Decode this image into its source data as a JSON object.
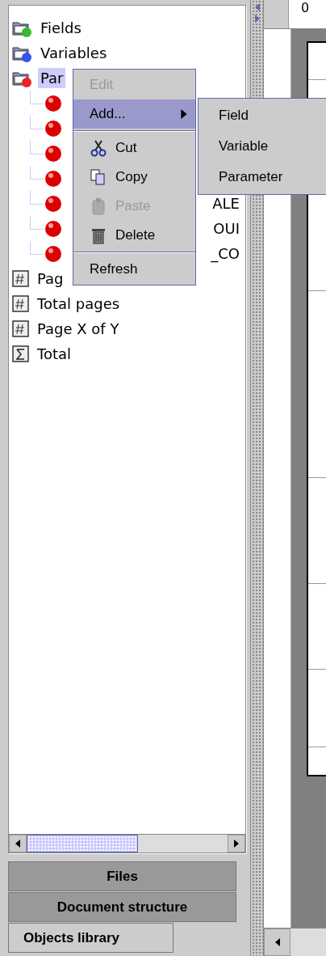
{
  "tree": [
    {
      "label": "Fields",
      "kind": "folder",
      "color": "#33bb33",
      "selected": false
    },
    {
      "label": "Variables",
      "kind": "folder",
      "color": "#3355ee",
      "selected": false
    },
    {
      "label": "Par",
      "kind": "folder",
      "color": "#ee2222",
      "selected": true,
      "children": [
        {
          "kind": "param"
        },
        {
          "kind": "param"
        },
        {
          "kind": "param"
        },
        {
          "kind": "param"
        },
        {
          "kind": "param",
          "label": "ALE"
        },
        {
          "kind": "param",
          "label": "OUI"
        },
        {
          "kind": "param",
          "label": "_CO"
        }
      ]
    },
    {
      "label": "Pag",
      "kind": "number",
      "selected": false
    },
    {
      "label": "Total pages",
      "kind": "number",
      "selected": false
    },
    {
      "label": "Page X of Y",
      "kind": "number",
      "selected": false
    },
    {
      "label": "Total",
      "kind": "sum",
      "selected": false
    }
  ],
  "context_menu": [
    {
      "kind": "item",
      "label": "Edit",
      "disabled": true,
      "selected": false
    },
    {
      "kind": "item",
      "label": "Add...",
      "disabled": false,
      "selected": true,
      "submenu": true
    },
    {
      "kind": "separator"
    },
    {
      "kind": "item",
      "label": "Cut",
      "disabled": false,
      "selected": false
    },
    {
      "kind": "item",
      "label": "Copy",
      "disabled": false,
      "selected": false
    },
    {
      "kind": "item",
      "label": "Paste",
      "disabled": true,
      "selected": false
    },
    {
      "kind": "item",
      "label": "Delete",
      "disabled": false,
      "selected": false
    },
    {
      "kind": "separator"
    },
    {
      "kind": "item",
      "label": "Refresh",
      "disabled": false,
      "selected": false
    }
  ],
  "submenu": [
    "Field",
    "Variable",
    "Parameter"
  ],
  "tabs": [
    {
      "label": "Files",
      "selected": false
    },
    {
      "label": "Document structure",
      "selected": false
    },
    {
      "label": "Objects library",
      "selected": true
    }
  ],
  "ruler": {
    "label": "0"
  }
}
